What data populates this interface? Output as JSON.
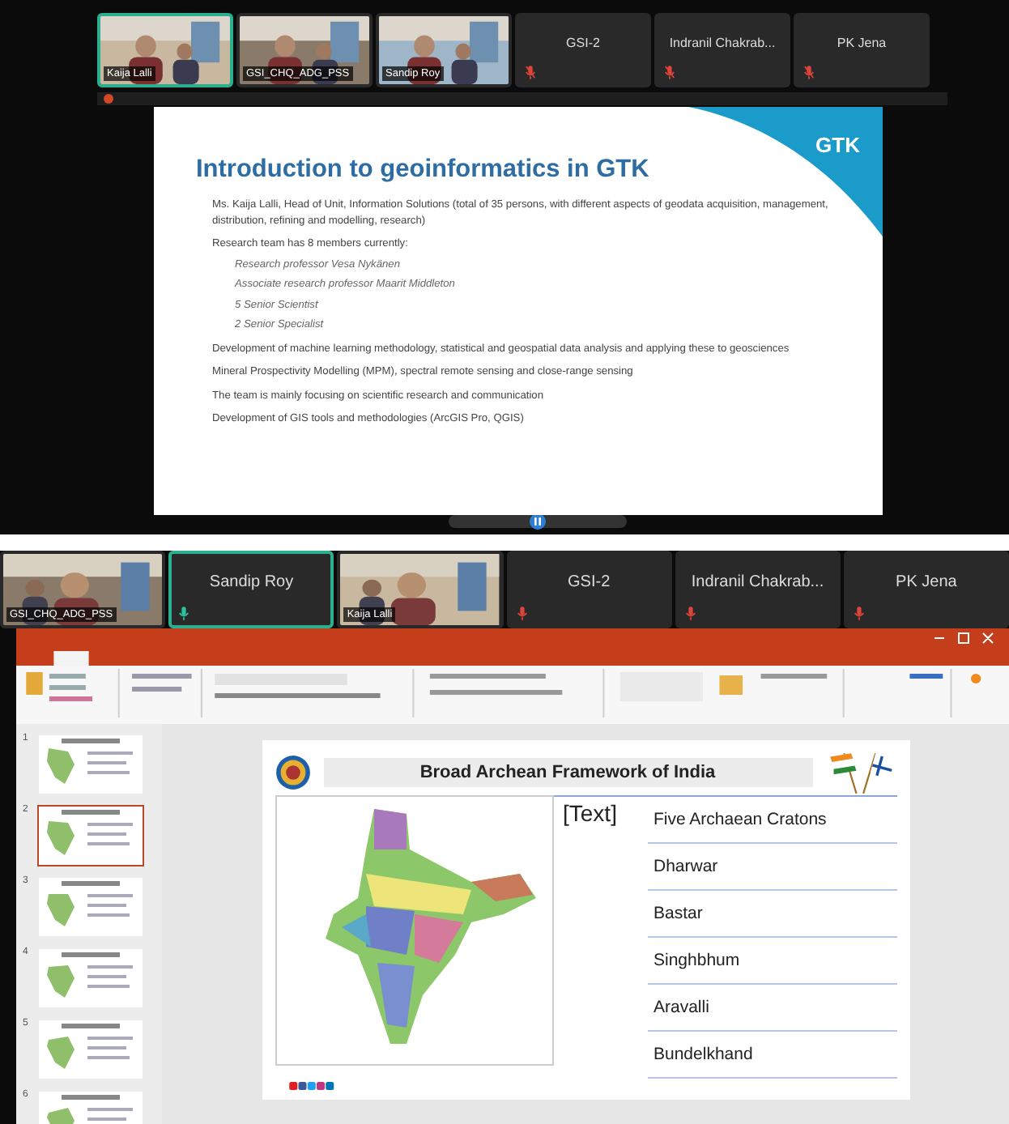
{
  "top_screen": {
    "tiles": [
      {
        "name": "Kaija Lalli",
        "kind": "video",
        "selected": true
      },
      {
        "name": "GSI_CHQ_ADG_PSS",
        "kind": "video",
        "selected": false
      },
      {
        "name": "Sandip Roy",
        "kind": "video",
        "selected": false
      },
      {
        "name": "GSI-2",
        "kind": "name",
        "selected": false
      },
      {
        "name": "Indranil Chakrab...",
        "kind": "name",
        "selected": false
      },
      {
        "name": "PK Jena",
        "kind": "name",
        "selected": false
      }
    ],
    "slide": {
      "logo": "GTK",
      "title": "Introduction to geoinformatics in GTK",
      "bullets": [
        {
          "text": "Ms. Kaija Lalli, Head of Unit, Information Solutions (total of 35 persons, with different aspects of geodata acquisition, management, distribution, refining and modelling, research)"
        },
        {
          "text": "Research team has 8 members currently:",
          "children": [
            {
              "text": "Research professor Vesa Nykänen"
            },
            {
              "text": "Associate research professor Maarit Middleton"
            },
            {
              "text": "5 Senior Scientist"
            },
            {
              "text": "2 Senior Specialist"
            }
          ]
        },
        {
          "text": "Development of machine learning methodology, statistical and geospatial data analysis and applying these to geosciences"
        },
        {
          "text": "Mineral Prospectivity Modelling (MPM), spectral remote sensing and close-range sensing"
        },
        {
          "text": "The team is mainly focusing on scientific research and communication"
        },
        {
          "text": "Development of GIS tools and methodologies (ArcGIS Pro, QGIS)"
        }
      ]
    }
  },
  "bottom_screen": {
    "tiles": [
      {
        "name": "GSI_CHQ_ADG_PSS",
        "kind": "video",
        "selected": false
      },
      {
        "name": "Sandip Roy",
        "kind": "name",
        "selected": true
      },
      {
        "name": "Kaija Lalli",
        "kind": "video",
        "selected": false
      },
      {
        "name": "GSI-2",
        "kind": "name",
        "selected": false
      },
      {
        "name": "Indranil Chakrab...",
        "kind": "name",
        "selected": false
      },
      {
        "name": "PK Jena",
        "kind": "name",
        "selected": false
      }
    ],
    "thumbnails": [
      {
        "number": "1",
        "selected": false
      },
      {
        "number": "2",
        "selected": true
      },
      {
        "number": "3",
        "selected": false
      },
      {
        "number": "4",
        "selected": false
      },
      {
        "number": "5",
        "selected": false
      },
      {
        "number": "6",
        "selected": false
      }
    ],
    "slide": {
      "title": "Broad Archean Framework of India",
      "placeholder": "[Text]",
      "items": [
        "Five Archaean Cratons",
        "Dharwar",
        "Bastar",
        "Singhbhum",
        "Aravalli",
        "Bundelkhand"
      ]
    }
  }
}
